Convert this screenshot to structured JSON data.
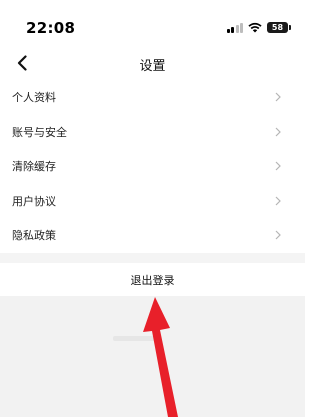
{
  "status_bar": {
    "time": "22:08",
    "battery": "58",
    "icons": [
      "signal-icon",
      "wifi-icon",
      "battery-icon"
    ]
  },
  "nav": {
    "title": "设置",
    "back_icon": "chevron-left-icon"
  },
  "settings": {
    "items": [
      {
        "label": "个人资料"
      },
      {
        "label": "账号与安全"
      },
      {
        "label": "清除缓存"
      },
      {
        "label": "用户协议"
      },
      {
        "label": "隐私政策"
      }
    ],
    "item_icon": "chevron-right-icon"
  },
  "logout": {
    "label": "退出登录"
  },
  "annotation": {
    "type": "red-arrow",
    "color": "#e8202a",
    "points_to": "logout-button"
  },
  "colors": {
    "background": "#ffffff",
    "divider_gap": "#f4f4f4",
    "bottom_area": "#f2f2f2",
    "chevron": "#b5b5b5"
  }
}
